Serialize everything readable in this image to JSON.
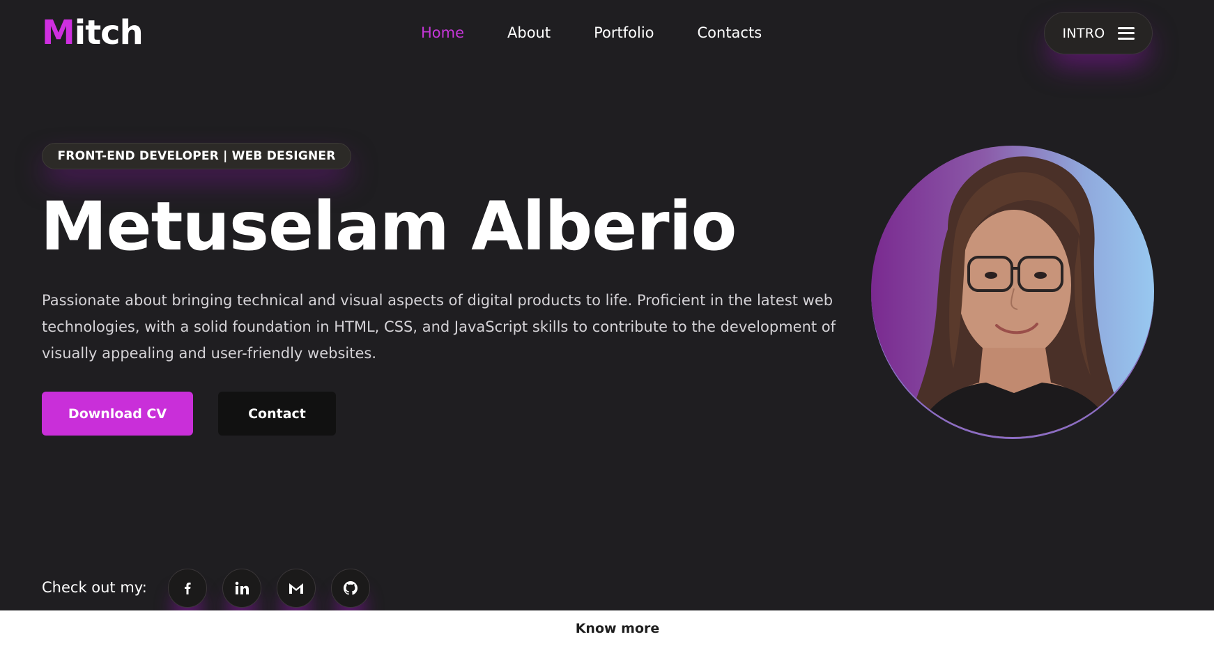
{
  "header": {
    "logo_first": "M",
    "logo_rest": "itch",
    "nav": [
      {
        "label": "Home",
        "active": true
      },
      {
        "label": "About",
        "active": false
      },
      {
        "label": "Portfolio",
        "active": false
      },
      {
        "label": "Contacts",
        "active": false
      }
    ],
    "intro_label": "INTRO",
    "intro_icon": "hamburger-icon"
  },
  "hero": {
    "role": "FRONT-END DEVELOPER | WEB DESIGNER",
    "name": "Metuselam Alberio",
    "bio": "Passionate about bringing technical and visual aspects of digital products to life. Proficient in the latest web technologies, with a solid foundation in HTML, CSS, and JavaScript skills to contribute to the development of visually appealing and user-friendly websites.",
    "download_label": "Download CV",
    "contact_label": "Contact",
    "avatar_icon": "profile-photo"
  },
  "socials": {
    "label": "Check out my:",
    "items": [
      {
        "icon": "facebook-icon"
      },
      {
        "icon": "linkedin-icon"
      },
      {
        "icon": "gmail-icon"
      },
      {
        "icon": "github-icon"
      }
    ]
  },
  "footer": {
    "know_more": "Know more"
  },
  "colors": {
    "background": "#1f1e21",
    "accent": "#c92fd9",
    "nav_active": "#c536d8"
  }
}
